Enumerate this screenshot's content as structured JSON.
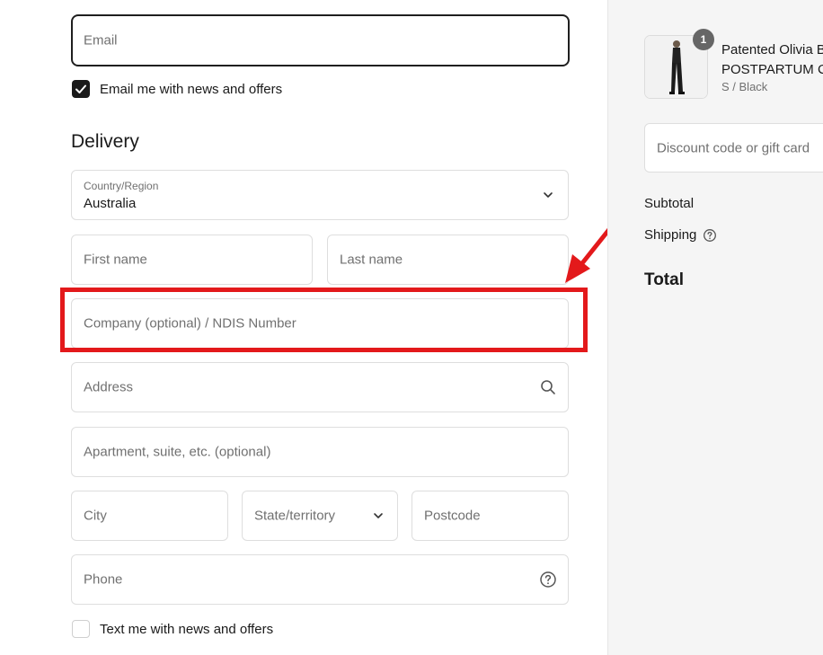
{
  "contact": {
    "email_placeholder": "Email",
    "news_checkbox_label": "Email me with news and offers",
    "news_checked": true
  },
  "delivery": {
    "heading": "Delivery",
    "country_label": "Country/Region",
    "country_value": "Australia",
    "first_name_placeholder": "First name",
    "last_name_placeholder": "Last name",
    "company_placeholder": "Company (optional) / NDIS Number",
    "address_placeholder": "Address",
    "apartment_placeholder": "Apartment, suite, etc. (optional)",
    "city_placeholder": "City",
    "state_placeholder": "State/territory",
    "postcode_placeholder": "Postcode",
    "phone_placeholder": "Phone",
    "sms_checkbox_label": "Text me with news and offers",
    "sms_checked": false
  },
  "summary": {
    "quantity": "1",
    "product_line1": "Patented Olivia B",
    "product_line2": "POSTPARTUM C",
    "product_variant": "S / Black",
    "discount_placeholder": "Discount code or gift card",
    "subtotal_label": "Subtotal",
    "shipping_label": "Shipping",
    "total_label": "Total"
  },
  "colors": {
    "highlight": "#e3191b",
    "checkbox_checked": "#1a1a1a",
    "panel_bg": "#f5f5f5"
  }
}
